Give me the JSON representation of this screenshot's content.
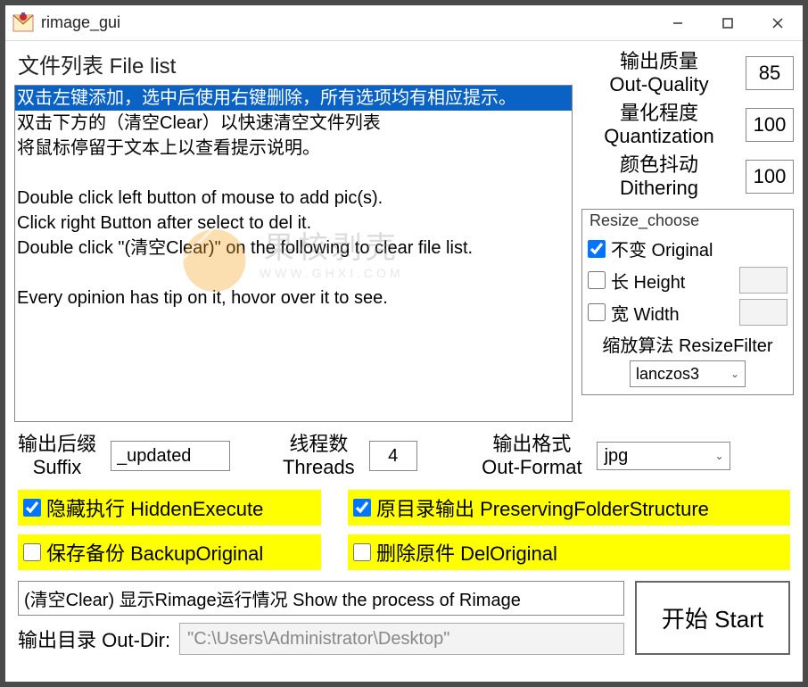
{
  "window": {
    "title": "rimage_gui"
  },
  "filelist": {
    "title": "文件列表 File list",
    "lines": [
      "双击左键添加，选中后使用右键删除，所有选项均有相应提示。",
      "双击下方的（清空Clear）以快速清空文件列表",
      "将鼠标停留于文本上以查看提示说明。",
      "",
      "Double click left button of mouse to add pic(s).",
      "Click right Button after select to del it.",
      "Double click \"(清空Clear)\" on the following to clear file list.",
      "",
      "Every opinion has tip on it, hovor over it to see."
    ],
    "selected_index": 0
  },
  "params": {
    "out_quality": {
      "label_cn": "输出质量",
      "label_en": "Out-Quality",
      "value": "85"
    },
    "quantization": {
      "label_cn": "量化程度",
      "label_en": "Quantization",
      "value": "100"
    },
    "dithering": {
      "label_cn": "颜色抖动",
      "label_en": "Dithering",
      "value": "100"
    }
  },
  "resize": {
    "legend": "Resize_choose",
    "original": {
      "label": "不变 Original",
      "checked": true
    },
    "height": {
      "label": "长 Height",
      "checked": false,
      "value": ""
    },
    "width": {
      "label": "宽 Width",
      "checked": false,
      "value": ""
    },
    "filter_label": "缩放算法 ResizeFilter",
    "filter_value": "lanczos3"
  },
  "mid": {
    "suffix": {
      "label_cn": "输出后缀",
      "label_en": "Suffix",
      "value": "_updated"
    },
    "threads": {
      "label_cn": "线程数",
      "label_en": "Threads",
      "value": "4"
    },
    "out_format": {
      "label_cn": "输出格式",
      "label_en": "Out-Format",
      "value": "jpg"
    }
  },
  "checks": {
    "hidden_execute": {
      "label": "隐藏执行 HiddenExecute",
      "checked": true
    },
    "preserve_folder": {
      "label": "原目录输出 PreservingFolderStructure",
      "checked": true
    },
    "backup_original": {
      "label": "保存备份 BackupOriginal",
      "checked": false
    },
    "del_original": {
      "label": "删除原件 DelOriginal",
      "checked": false
    }
  },
  "process_box": "(清空Clear) 显示Rimage运行情况 Show the process of Rimage",
  "out_dir": {
    "label": "输出目录 Out-Dir:",
    "value": "\"C:\\Users\\Administrator\\Desktop\""
  },
  "start_btn": "开始 Start",
  "watermark": {
    "cn": "果核剥壳",
    "url": "WWW.GHXI.COM"
  }
}
